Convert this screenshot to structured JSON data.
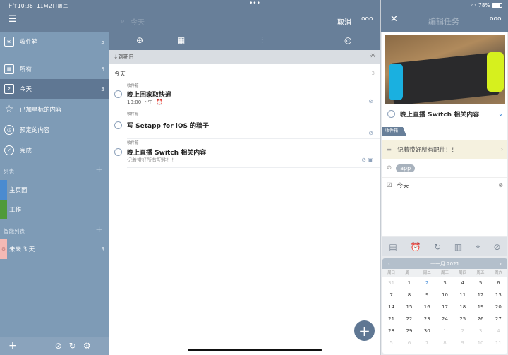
{
  "status": {
    "time": "上午10:36",
    "date": "11月2日周二",
    "battery": "78%"
  },
  "sidebar": {
    "items": [
      {
        "label": "收件箱",
        "count": "5"
      },
      {
        "label": "所有",
        "count": "5"
      },
      {
        "label": "今天",
        "count": "3"
      },
      {
        "label": "已加星标的内容",
        "count": ""
      },
      {
        "label": "预定的内容",
        "count": ""
      },
      {
        "label": "完成",
        "count": ""
      }
    ],
    "lists_header": "列表",
    "lists": [
      {
        "label": "主页面",
        "color": "#4a8bd0"
      },
      {
        "label": "工作",
        "color": "#4f9a3a"
      }
    ],
    "smart_header": "智能列表",
    "smart": [
      {
        "label": "未来 3 天",
        "count": "3",
        "color": "#f3b9b5"
      }
    ]
  },
  "middle": {
    "search_placeholder": "今天",
    "cancel": "取消",
    "sort": "↓到期日",
    "section": "今天",
    "section_count": "3",
    "tasks": [
      {
        "list": "收件箱",
        "title": "晚上回家取快递",
        "sub": "10:00 下午"
      },
      {
        "list": "收件箱",
        "title": "写 Setapp for iOS 的稿子",
        "sub": ""
      },
      {
        "list": "收件箱",
        "title": "晚上直播 Switch 相关内容",
        "sub": "记着带好所有配件！！"
      }
    ]
  },
  "detail": {
    "header": "编辑任务",
    "title": "晚上直播 Switch 相关内容",
    "list": "收件箱",
    "note": "记着带好所有配件！！",
    "tag": "app",
    "date": "今天",
    "calendar": {
      "month": "十一月 2021",
      "weekdays": [
        "周日",
        "周一",
        "周二",
        "周三",
        "周四",
        "周五",
        "周六"
      ],
      "days": [
        "31",
        "1",
        "2",
        "3",
        "4",
        "5",
        "6",
        "7",
        "8",
        "9",
        "10",
        "11",
        "12",
        "13",
        "14",
        "15",
        "16",
        "17",
        "18",
        "19",
        "20",
        "21",
        "22",
        "23",
        "24",
        "25",
        "26",
        "27",
        "28",
        "29",
        "30",
        "1",
        "2",
        "3",
        "4",
        "5",
        "6",
        "7",
        "8",
        "9",
        "10",
        "11"
      ]
    }
  }
}
